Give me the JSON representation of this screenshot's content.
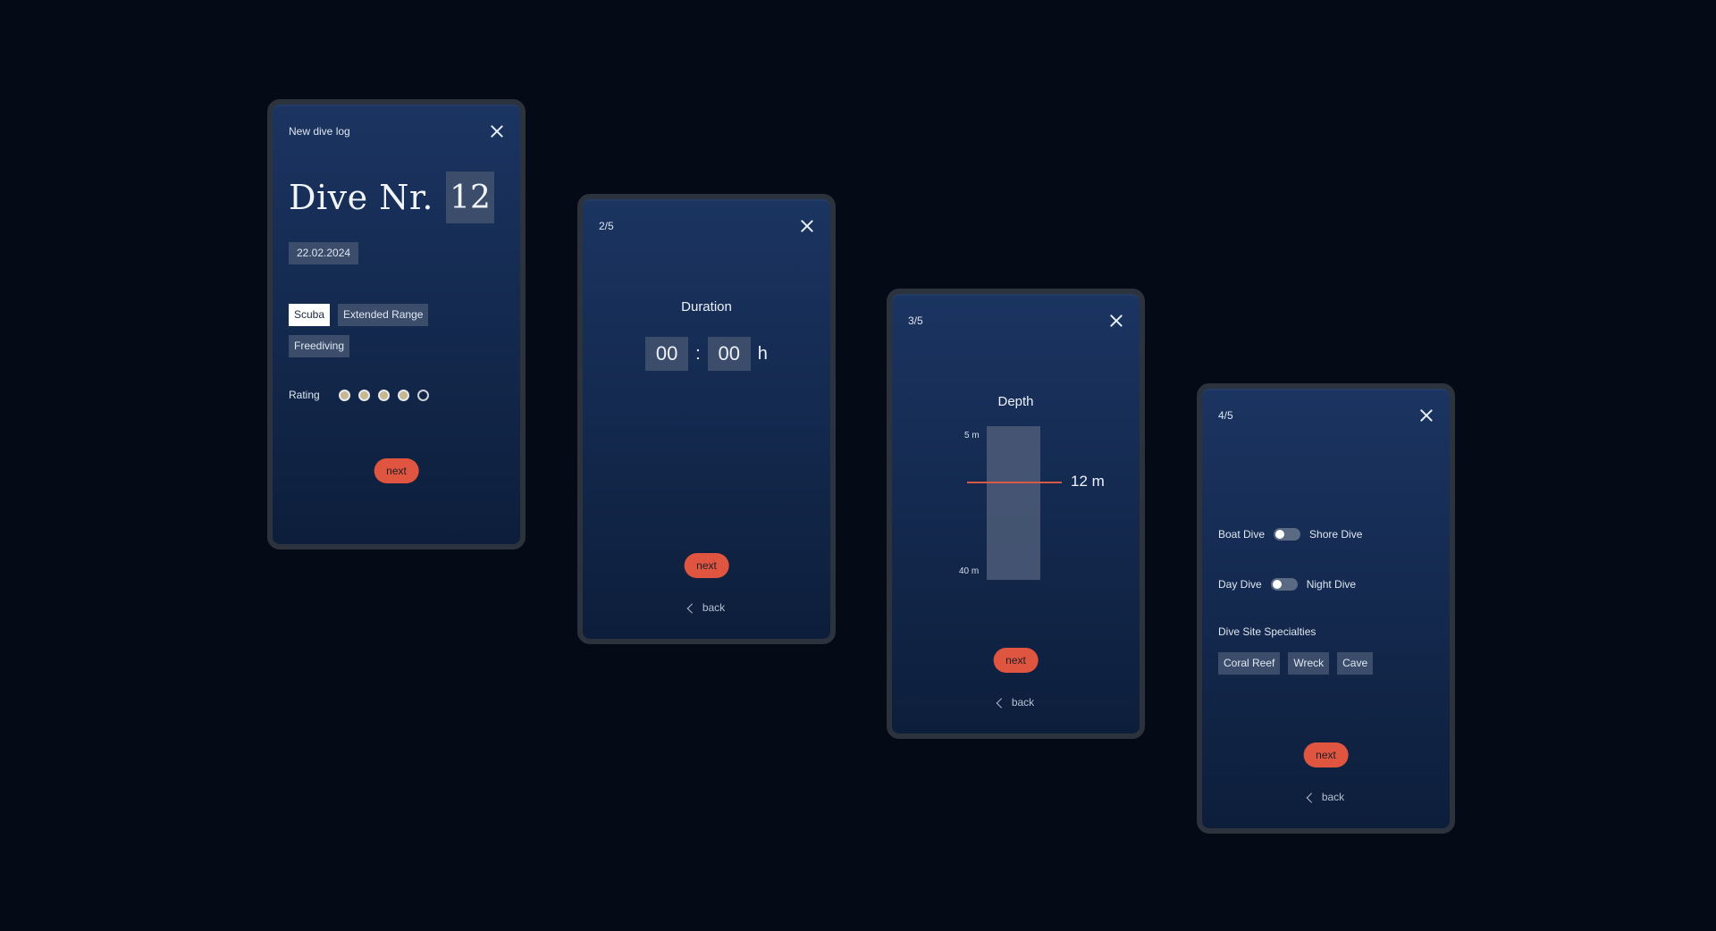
{
  "colors": {
    "background": "#050b16",
    "card_top": "#1b3461",
    "card_bottom": "#0d1e3b",
    "chip": "#3c4d6b",
    "accent_button": "#e0553f",
    "rating_filled": "#c6b78f",
    "depth_marker": "#d35a44"
  },
  "card1": {
    "header": "New dive log",
    "close_icon": "close-icon",
    "title": "Dive Nr.",
    "dive_number": "12",
    "date": "22.02.2024",
    "dive_types": [
      "Scuba",
      "Extended Range",
      "Freediving"
    ],
    "selected_type": "Scuba",
    "rating_label": "Rating",
    "rating_value": 4,
    "rating_max": 5,
    "next_label": "next"
  },
  "card2": {
    "step": "2/5",
    "title": "Duration",
    "hours": "00",
    "separator": ":",
    "minutes": "00",
    "unit": "h",
    "next_label": "next",
    "back_label": "back"
  },
  "card3": {
    "step": "3/5",
    "title": "Depth",
    "scale_top": "5 m",
    "scale_bottom": "40 m",
    "value": "12 m",
    "next_label": "next",
    "back_label": "back"
  },
  "card4": {
    "step": "4/5",
    "toggle1_left": "Boat Dive",
    "toggle1_right": "Shore Dive",
    "toggle2_left": "Day Dive",
    "toggle2_right": "Night Dive",
    "specialties_label": "Dive Site Specialties",
    "specialties": [
      "Coral Reef",
      "Wreck",
      "Cave"
    ],
    "next_label": "next",
    "back_label": "back"
  }
}
